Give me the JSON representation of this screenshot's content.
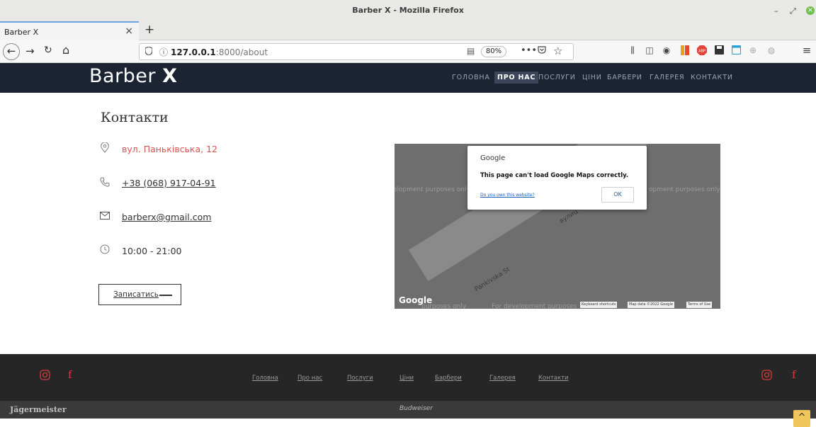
{
  "window": {
    "title": "Barber X - Mozilla Firefox",
    "controls": {
      "minimize": "–",
      "restore": "⤢",
      "close": "×"
    }
  },
  "tab": {
    "label": "Barber X",
    "close": "×",
    "new_tab": "+"
  },
  "nav": {
    "back": "←",
    "forward": "→",
    "reload": "↻",
    "home": "⌂",
    "url_host": "127.0.0.1",
    "url_rest": ":8000/about",
    "zoom": "80%",
    "more": "•••",
    "bookmark": "☆",
    "menu": "≡"
  },
  "site": {
    "logo_main": "Barber ",
    "logo_bold": "X",
    "menu": [
      "ГОЛОВНА",
      "ПРО НАС",
      "ПОСЛУГИ",
      "ЦІНИ",
      "БАРБЕРИ",
      "ГАЛЕРЕЯ",
      "КОНТАКТИ"
    ],
    "active_menu": "ПРО НАС"
  },
  "contacts": {
    "title": "Контакти",
    "address": "вул. Паньківська, 12",
    "phone": "+38 (068) 917-04-91",
    "email": "barberx@gmail.com",
    "hours": "10:00 - 21:00",
    "cta_label": "Записатись"
  },
  "map": {
    "dialog_title": "Google",
    "dialog_message": "This page can't load Google Maps correctly.",
    "dialog_link": "Do you own this website?",
    "dialog_ok": "OK",
    "dev_text": "For development purposes only",
    "dev_left": "elopment purposes only",
    "dev_right": "opment purposes only",
    "dev_bottom_left": "purposes only",
    "dev_bottom_mid": "For development purposes",
    "street1": "Pankivska St",
    "street2": "вулиц",
    "google_logo": "Google",
    "footer_shortcuts": "Keyboard shortcuts",
    "footer_data": "Map data ©2022 Google",
    "footer_terms": "Terms of Use"
  },
  "footer": {
    "links": [
      "Головна",
      "Про нас",
      "Послуги",
      "Ціни",
      "Барбери",
      "Галерея",
      "Контакти"
    ],
    "brand_left": "Jägermeister",
    "brand_mid": "Budweiser",
    "to_top": "^"
  }
}
